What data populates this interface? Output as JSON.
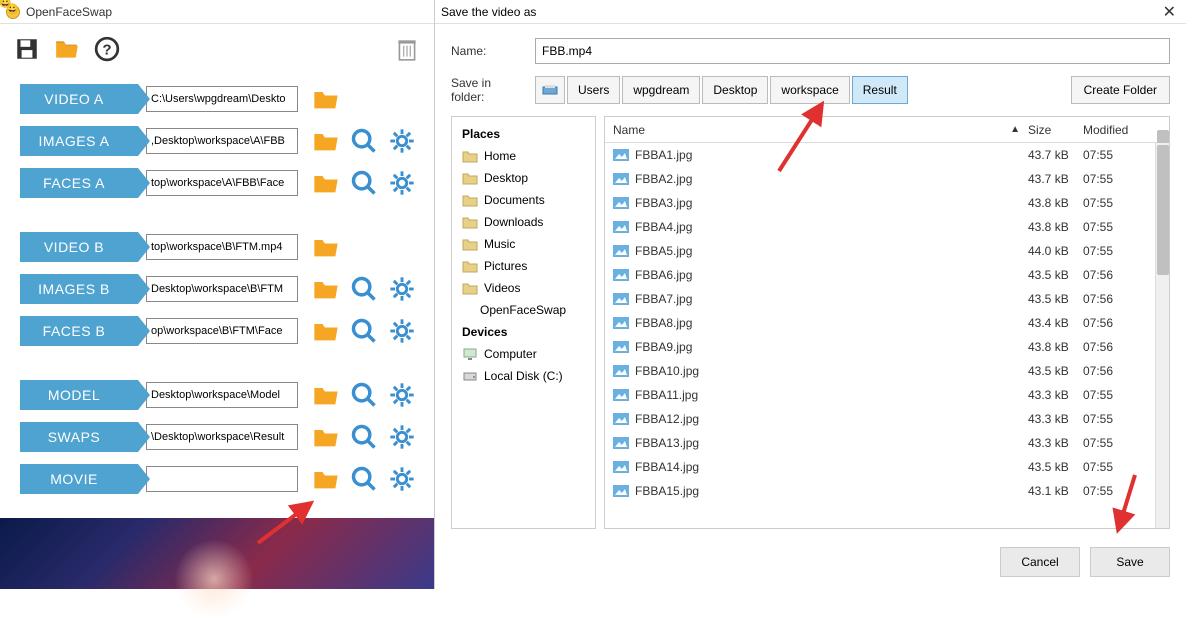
{
  "left": {
    "title": "OpenFaceSwap",
    "rows": [
      {
        "label": "VIDEO A",
        "path": "C:\\Users\\wpgdream\\Deskto",
        "icons": "folder"
      },
      {
        "label": "IMAGES A",
        "path": ",Desktop\\workspace\\A\\FBB",
        "icons": "all"
      },
      {
        "label": "FACES A",
        "path": "top\\workspace\\A\\FBB\\Face",
        "icons": "all"
      },
      {
        "gap": true
      },
      {
        "label": "VIDEO B",
        "path": "top\\workspace\\B\\FTM.mp4",
        "icons": "folder"
      },
      {
        "label": "IMAGES B",
        "path": "Desktop\\workspace\\B\\FTM",
        "icons": "all"
      },
      {
        "label": "FACES B",
        "path": "op\\workspace\\B\\FTM\\Face",
        "icons": "all"
      },
      {
        "gap": true
      },
      {
        "label": "MODEL",
        "path": "Desktop\\workspace\\Model",
        "icons": "all"
      },
      {
        "label": "SWAPS",
        "path": "\\Desktop\\workspace\\Result",
        "icons": "all"
      },
      {
        "label": "MOVIE",
        "path": "",
        "icons": "all"
      }
    ]
  },
  "dialog": {
    "title": "Save the video as",
    "name_label": "Name:",
    "name_value": "FBB.mp4",
    "folder_label": "Save in folder:",
    "create_folder": "Create Folder",
    "breadcrumb": [
      "Users",
      "wpgdream",
      "Desktop",
      "workspace",
      "Result"
    ],
    "active_crumb": 4,
    "places_header": "Places",
    "places": [
      "Home",
      "Desktop",
      "Documents",
      "Downloads",
      "Music",
      "Pictures",
      "Videos"
    ],
    "places_sub": "OpenFaceSwap",
    "devices_header": "Devices",
    "devices": [
      "Computer",
      "Local Disk (C:)"
    ],
    "col_name": "Name",
    "col_size": "Size",
    "col_mod": "Modified",
    "files": [
      {
        "n": "FBBA1.jpg",
        "s": "43.7 kB",
        "m": "07:55"
      },
      {
        "n": "FBBA2.jpg",
        "s": "43.7 kB",
        "m": "07:55"
      },
      {
        "n": "FBBA3.jpg",
        "s": "43.8 kB",
        "m": "07:55"
      },
      {
        "n": "FBBA4.jpg",
        "s": "43.8 kB",
        "m": "07:55"
      },
      {
        "n": "FBBA5.jpg",
        "s": "44.0 kB",
        "m": "07:55"
      },
      {
        "n": "FBBA6.jpg",
        "s": "43.5 kB",
        "m": "07:56"
      },
      {
        "n": "FBBA7.jpg",
        "s": "43.5 kB",
        "m": "07:56"
      },
      {
        "n": "FBBA8.jpg",
        "s": "43.4 kB",
        "m": "07:56"
      },
      {
        "n": "FBBA9.jpg",
        "s": "43.8 kB",
        "m": "07:56"
      },
      {
        "n": "FBBA10.jpg",
        "s": "43.5 kB",
        "m": "07:56"
      },
      {
        "n": "FBBA11.jpg",
        "s": "43.3 kB",
        "m": "07:55"
      },
      {
        "n": "FBBA12.jpg",
        "s": "43.3 kB",
        "m": "07:55"
      },
      {
        "n": "FBBA13.jpg",
        "s": "43.3 kB",
        "m": "07:55"
      },
      {
        "n": "FBBA14.jpg",
        "s": "43.5 kB",
        "m": "07:55"
      },
      {
        "n": "FBBA15.jpg",
        "s": "43.1 kB",
        "m": "07:55"
      }
    ],
    "cancel": "Cancel",
    "save": "Save"
  }
}
